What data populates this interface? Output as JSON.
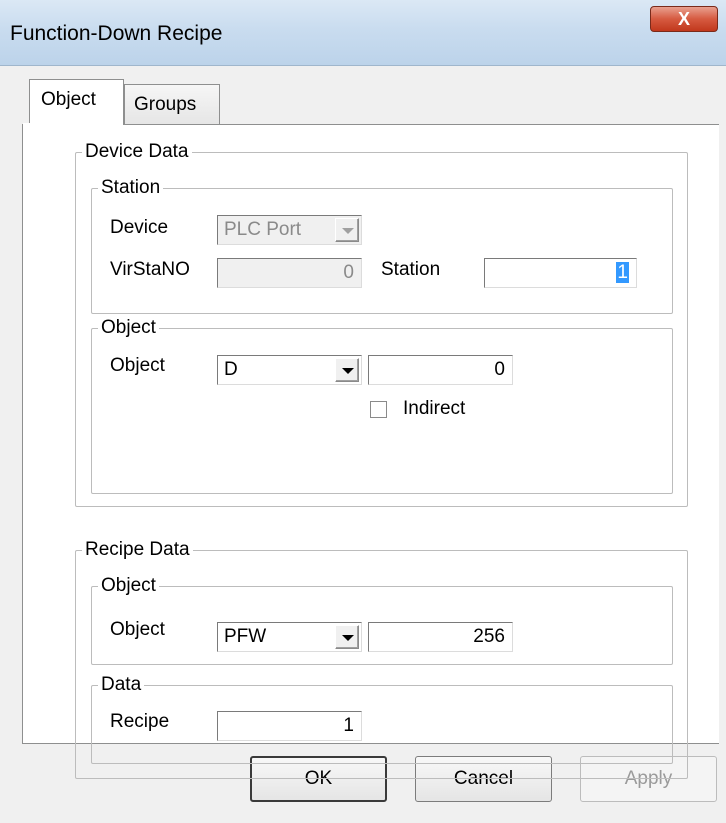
{
  "window": {
    "title": "Function-Down Recipe",
    "close_label": "X"
  },
  "tabs": [
    {
      "label": "Object",
      "active": true
    },
    {
      "label": "Groups",
      "active": false
    }
  ],
  "device_data": {
    "legend": "Device Data",
    "station": {
      "legend": "Station",
      "device_label": "Device",
      "device_value": "PLC Port",
      "virstano_label": "VirStaNO",
      "virstano_value": "0",
      "station_label": "Station",
      "station_value": "1"
    },
    "object": {
      "legend": "Object",
      "object_label": "Object",
      "object_type": "D",
      "object_address": "0",
      "indirect_label": "Indirect",
      "indirect_checked": false
    }
  },
  "recipe_data": {
    "legend": "Recipe Data",
    "object": {
      "legend": "Object",
      "object_label": "Object",
      "object_type": "PFW",
      "object_address": "256"
    },
    "data": {
      "legend": "Data",
      "recipe_label": "Recipe",
      "recipe_value": "1"
    }
  },
  "buttons": {
    "ok": "OK",
    "cancel": "Cancel",
    "apply": "Apply"
  },
  "colors": {
    "selection": "#3399ff",
    "close_button": "#c1381c"
  }
}
